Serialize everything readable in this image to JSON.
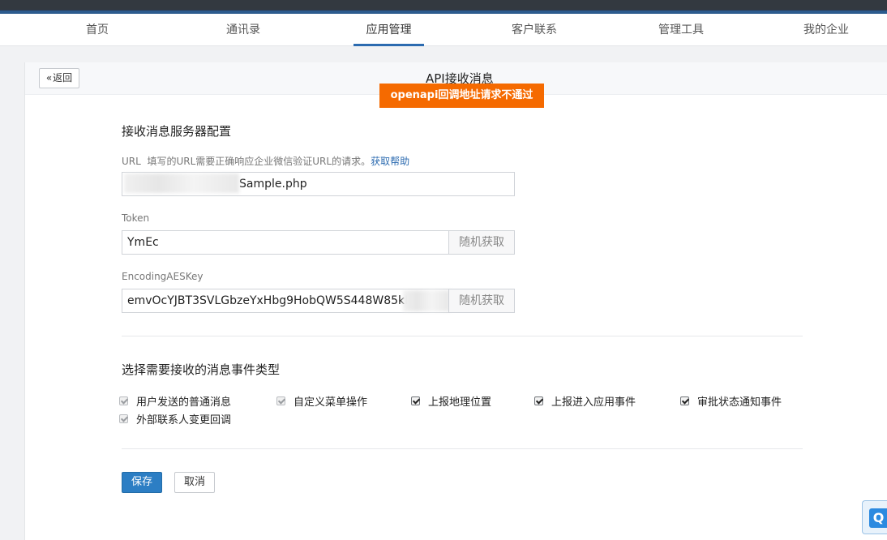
{
  "nav": {
    "items": [
      {
        "label": "首页",
        "active": false
      },
      {
        "label": "通讯录",
        "active": false
      },
      {
        "label": "应用管理",
        "active": true
      },
      {
        "label": "客户联系",
        "active": false
      },
      {
        "label": "管理工具",
        "active": false
      },
      {
        "label": "我的企业",
        "active": false
      }
    ]
  },
  "header": {
    "back_label": "返回",
    "title": "API接收消息"
  },
  "toast": {
    "message": "openapi回调地址请求不通过"
  },
  "server_config": {
    "section_title": "接收消息服务器配置",
    "url": {
      "label": "URL",
      "hint": "填写的URL需要正确响应企业微信验证URL的请求。",
      "help_link": "获取帮助",
      "value": "Sample.php"
    },
    "token": {
      "label": "Token",
      "value": "YmEc",
      "random_button": "随机获取"
    },
    "aes_key": {
      "label": "EncodingAESKey",
      "value": "emvOcYJBT3SVLGbzeYxHbg9HobQW5S448W85kRD",
      "random_button": "随机获取"
    }
  },
  "event_types": {
    "section_title": "选择需要接收的消息事件类型",
    "options": [
      {
        "label": "用户发送的普通消息",
        "checked": true,
        "disabled": true
      },
      {
        "label": "自定义菜单操作",
        "checked": true,
        "disabled": true
      },
      {
        "label": "上报地理位置",
        "checked": true,
        "disabled": false
      },
      {
        "label": "上报进入应用事件",
        "checked": true,
        "disabled": false
      },
      {
        "label": "审批状态通知事件",
        "checked": true,
        "disabled": false
      },
      {
        "label": "外部联系人变更回调",
        "checked": true,
        "disabled": true
      }
    ]
  },
  "actions": {
    "save_label": "保存",
    "cancel_label": "取消"
  },
  "floating": {
    "icon_letter": "Q"
  },
  "colors": {
    "accent": "#2c7ec4",
    "toast": "#f56a00",
    "nav_active": "#2c6bb0"
  }
}
